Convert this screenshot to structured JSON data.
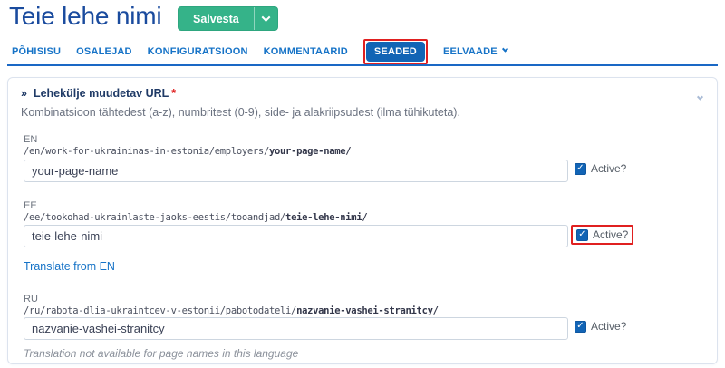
{
  "page": {
    "title": "Teie lehe nimi"
  },
  "toolbar": {
    "save_label": "Salvesta"
  },
  "tabs": [
    {
      "label": "PÕHISISU",
      "active": false
    },
    {
      "label": "OSALEJAD",
      "active": false
    },
    {
      "label": "KONFIGURATSIOON",
      "active": false
    },
    {
      "label": "KOMMENTAARID",
      "active": false
    },
    {
      "label": "SEADED",
      "active": true,
      "annotated": true
    },
    {
      "label": "EELVAADE",
      "active": false,
      "has_dropdown": true
    }
  ],
  "panel": {
    "bullet": "»",
    "title": "Lehekülje muudetav URL",
    "required_marker": "*",
    "description": "Kombinatsioon tähtedest (a-z), numbritest (0-9), side- ja alakriipsudest (ilma tühikuteta)."
  },
  "url_fields": {
    "en": {
      "lang": "EN",
      "path_prefix": "/en/work-for-ukraininas-in-estonia/employers/",
      "path_slug": "your-page-name/",
      "input_value": "your-page-name",
      "active_label": "Active?",
      "active_checked": true,
      "check_glyph": "✓"
    },
    "ee": {
      "lang": "EE",
      "path_prefix": "/ee/tookohad-ukrainlaste-jaoks-eestis/tooandjad/",
      "path_slug": "teie-lehe-nimi/",
      "input_value": "teie-lehe-nimi",
      "active_label": "Active?",
      "active_checked": true,
      "annotated": true,
      "check_glyph": "✓"
    },
    "ru": {
      "lang": "RU",
      "path_prefix": "/ru/rabota-dlia-ukraintcev-v-estonii/pabotodateli/",
      "path_slug": "nazvanie-vashei-stranitcy/",
      "input_value": "nazvanie-vashei-stranitcy",
      "active_label": "Active?",
      "active_checked": true,
      "check_glyph": "✓"
    }
  },
  "translate_link_label": "Translate from EN",
  "footer_note": "Translation not available for page names in this language",
  "colors": {
    "title_blue": "#1a4b9e",
    "tab_blue": "#1673c7",
    "active_tab_bg": "#1264b5",
    "save_green": "#35b389",
    "annotation_red": "#e02020",
    "checkbox_blue": "#1264b5",
    "panel_border": "#dce3ee"
  }
}
